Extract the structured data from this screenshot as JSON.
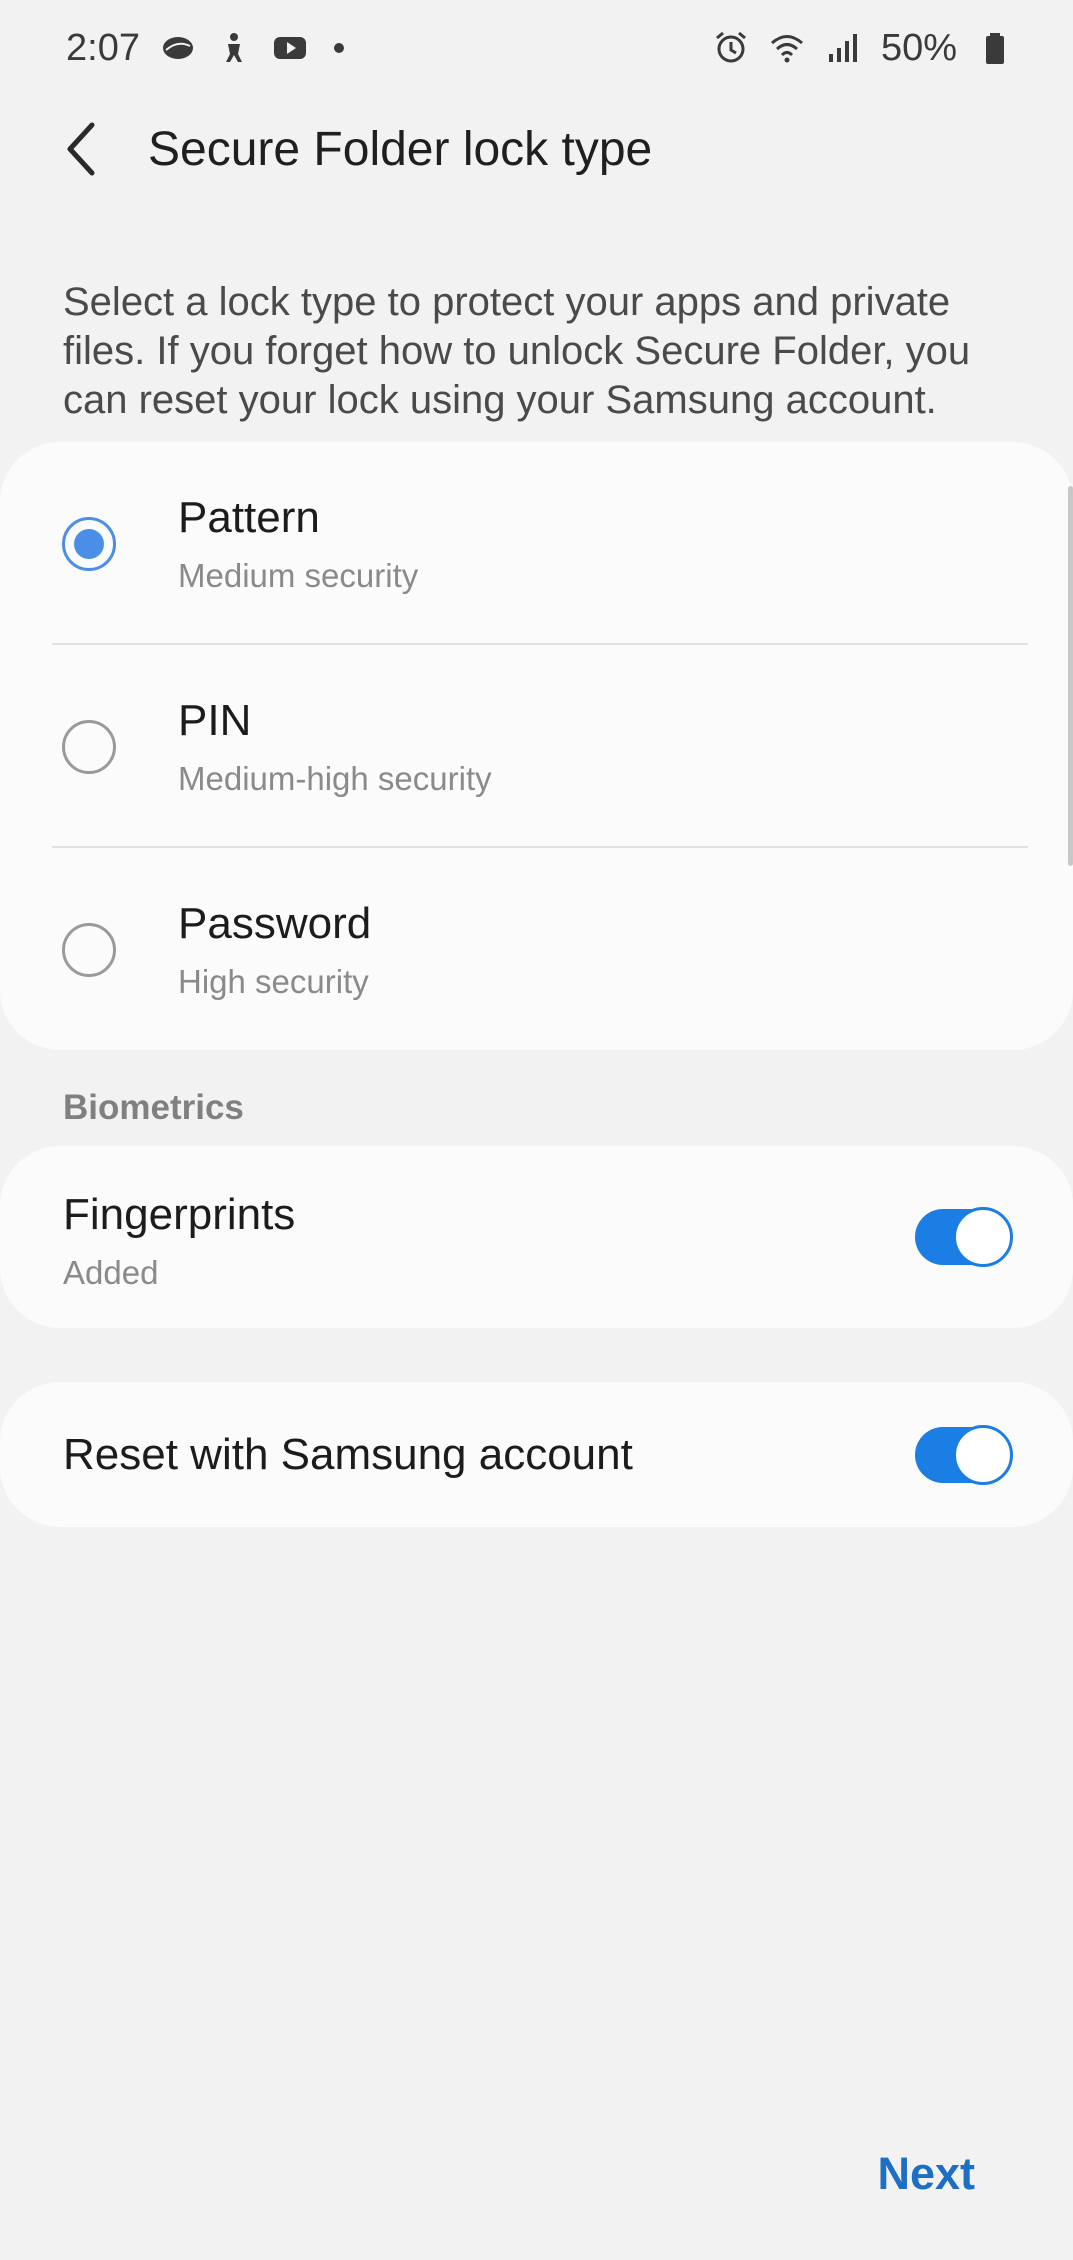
{
  "status_bar": {
    "time": "2:07",
    "left_icons": [
      "sms-app-icon",
      "accessibility-icon",
      "youtube-icon",
      "notification-dot-icon"
    ],
    "right_icons": [
      "alarm-icon",
      "wifi-icon",
      "signal-icon",
      "battery-icon"
    ],
    "battery": "50%"
  },
  "app_bar": {
    "back_icon": "chevron-left-icon",
    "title": "Secure Folder lock type"
  },
  "description": "Select a lock type to protect your apps and private files. If you forget how to unlock Secure Folder, you can reset your lock using your Samsung account.",
  "lock_options": [
    {
      "title": "Pattern",
      "subtitle": "Medium security",
      "selected": true
    },
    {
      "title": "PIN",
      "subtitle": "Medium-high security",
      "selected": false
    },
    {
      "title": "Password",
      "subtitle": "High security",
      "selected": false
    }
  ],
  "biometrics": {
    "section_label": "Biometrics",
    "fingerprints": {
      "title": "Fingerprints",
      "subtitle": "Added",
      "enabled": true
    }
  },
  "reset": {
    "title": "Reset with Samsung account",
    "enabled": true
  },
  "footer": {
    "next_label": "Next"
  },
  "colors": {
    "accent": "#4a8ee8",
    "toggle_on": "#1a7ee5",
    "next_text": "#1c6fc4",
    "background": "#f2f2f2",
    "card": "#fbfbfb"
  }
}
